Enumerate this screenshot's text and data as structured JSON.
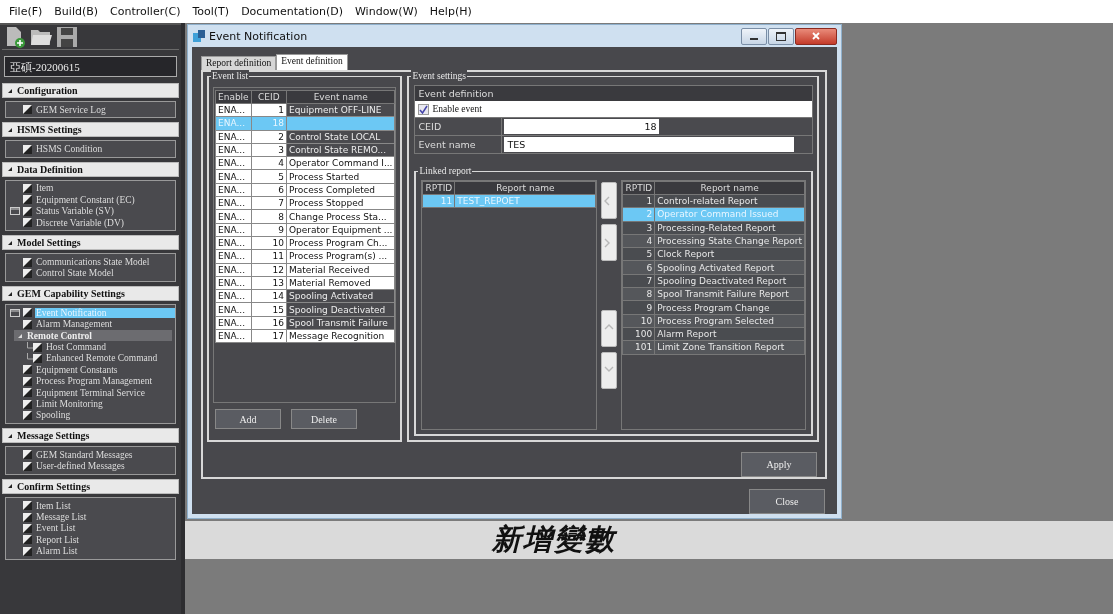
{
  "menu": [
    "File(F)",
    "Build(B)",
    "Controller(C)",
    "Tool(T)",
    "Documentation(D)",
    "Window(W)",
    "Help(H)"
  ],
  "project_name": "亞碩-20200615",
  "sidebar": [
    {
      "title": "Configuration",
      "items": [
        {
          "label": "GEM Service Log",
          "marked": false,
          "selected": false
        }
      ]
    },
    {
      "title": "HSMS Settings",
      "items": [
        {
          "label": "HSMS Condition",
          "marked": false,
          "selected": false
        }
      ]
    },
    {
      "title": "Data Definition",
      "items": [
        {
          "label": "Item",
          "marked": false,
          "selected": false
        },
        {
          "label": "Equipment Constant (EC)",
          "marked": false,
          "selected": false
        },
        {
          "label": "Status Variable (SV)",
          "marked": true,
          "selected": false
        },
        {
          "label": "Discrete Variable (DV)",
          "marked": false,
          "selected": false
        }
      ]
    },
    {
      "title": "Model Settings",
      "items": [
        {
          "label": "Communications State Model",
          "marked": false,
          "selected": false
        },
        {
          "label": "Control State Model",
          "marked": false,
          "selected": false
        }
      ]
    },
    {
      "title": "GEM Capability Settings",
      "items": [
        {
          "label": "Event Notification",
          "marked": true,
          "selected": true
        },
        {
          "label": "Alarm Management",
          "marked": false,
          "selected": false
        },
        {
          "label": "Remote Control",
          "kind": "group",
          "expanded": true,
          "children": [
            {
              "label": "Host Command",
              "marked": false,
              "selected": false
            },
            {
              "label": "Enhanced Remote Command",
              "marked": false,
              "selected": false
            }
          ]
        },
        {
          "label": "Equipment Constants",
          "marked": false,
          "selected": false
        },
        {
          "label": "Process Program Management",
          "marked": false,
          "selected": false
        },
        {
          "label": "Equipment Terminal Service",
          "marked": false,
          "selected": false
        },
        {
          "label": "Limit Monitoring",
          "marked": false,
          "selected": false
        },
        {
          "label": "Spooling",
          "marked": false,
          "selected": false
        }
      ]
    },
    {
      "title": "Message Settings",
      "items": [
        {
          "label": "GEM Standard Messages",
          "marked": false,
          "selected": false
        },
        {
          "label": "User-defined Messages",
          "marked": false,
          "selected": false
        }
      ]
    },
    {
      "title": "Confirm Settings",
      "items": [
        {
          "label": "Item List",
          "marked": false,
          "selected": false
        },
        {
          "label": "Message List",
          "marked": false,
          "selected": false
        },
        {
          "label": "Event List",
          "marked": false,
          "selected": false
        },
        {
          "label": "Report List",
          "marked": false,
          "selected": false
        },
        {
          "label": "Alarm List",
          "marked": false,
          "selected": false
        }
      ]
    }
  ],
  "dialog": {
    "title": "Event Notification",
    "tabs": [
      {
        "label": "Report definition",
        "selected": false
      },
      {
        "label": "Event definition",
        "selected": true
      }
    ],
    "event_list": {
      "title": "Event list",
      "columns": [
        "Enable",
        "CEID",
        "Event name"
      ],
      "rows": [
        {
          "enable": "ENA...",
          "ceid": "1",
          "name": "Equipment OFF-LINE",
          "shaded": true,
          "selected": false
        },
        {
          "enable": "ENA...",
          "ceid": "18",
          "shaded": false,
          "selected": true
        },
        {
          "enable": "ENA...",
          "ceid": "2",
          "name": "Control State LOCAL",
          "shaded": true,
          "selected": false
        },
        {
          "enable": "ENA...",
          "ceid": "3",
          "name": "Control State REMO...",
          "shaded": true,
          "selected": false
        },
        {
          "enable": "ENA...",
          "ceid": "4",
          "name": "Operator Command I...",
          "shaded": false,
          "selected": false
        },
        {
          "enable": "ENA...",
          "ceid": "5",
          "name": "Process Started",
          "shaded": false,
          "selected": false
        },
        {
          "enable": "ENA...",
          "ceid": "6",
          "name": "Process Completed",
          "shaded": false,
          "selected": false
        },
        {
          "enable": "ENA...",
          "ceid": "7",
          "name": "Process Stopped",
          "shaded": false,
          "selected": false
        },
        {
          "enable": "ENA...",
          "ceid": "8",
          "name": "Change Process Sta...",
          "shaded": false,
          "selected": false
        },
        {
          "enable": "ENA...",
          "ceid": "9",
          "name": "Operator Equipment ...",
          "shaded": false,
          "selected": false
        },
        {
          "enable": "ENA...",
          "ceid": "10",
          "name": "Process Program Ch...",
          "shaded": false,
          "selected": false
        },
        {
          "enable": "ENA...",
          "ceid": "11",
          "name": "Process Program(s) ...",
          "shaded": false,
          "selected": false
        },
        {
          "enable": "ENA...",
          "ceid": "12",
          "name": "Material Received",
          "shaded": false,
          "selected": false
        },
        {
          "enable": "ENA...",
          "ceid": "13",
          "name": "Material Removed",
          "shaded": false,
          "selected": false
        },
        {
          "enable": "ENA...",
          "ceid": "14",
          "name": "Spooling Activated",
          "shaded": true,
          "selected": false
        },
        {
          "enable": "ENA...",
          "ceid": "15",
          "name": "Spooling Deactivated",
          "shaded": true,
          "selected": false
        },
        {
          "enable": "ENA...",
          "ceid": "16",
          "name": "Spool Transmit Failure",
          "shaded": true,
          "selected": false
        },
        {
          "enable": "ENA...",
          "ceid": "17",
          "name": "Message Recognition",
          "shaded": false,
          "selected": false
        }
      ],
      "buttons": [
        "Add",
        "Delete"
      ]
    },
    "event_settings": {
      "title": "Event settings",
      "header": "Event definition",
      "enable_label": "Enable event",
      "enable_checked": true,
      "ceid_label": "CEID",
      "ceid_value": "18",
      "name_label": "Event name",
      "name_value": "TES"
    },
    "linked_report": {
      "title": "Linked report",
      "columns": [
        "RPTID",
        "Report name"
      ],
      "rows": [
        {
          "rptid": "11",
          "name": "TEST_REPOET",
          "selected": true
        }
      ]
    },
    "report_list": {
      "columns": [
        "RPTID",
        "Report name"
      ],
      "rows": [
        {
          "rptid": "1",
          "name": "Control-related Report",
          "selected": false
        },
        {
          "rptid": "2",
          "name": "Operator Command Issued",
          "selected": true
        },
        {
          "rptid": "3",
          "name": "Processing-Related Report",
          "selected": false
        },
        {
          "rptid": "4",
          "name": "Processing State Change Report",
          "selected": false
        },
        {
          "rptid": "5",
          "name": "Clock Report",
          "selected": false
        },
        {
          "rptid": "6",
          "name": "Spooling Activated Report",
          "selected": false
        },
        {
          "rptid": "7",
          "name": "Spooling Deactivated Report",
          "selected": false
        },
        {
          "rptid": "8",
          "name": "Spool Transmit Failure Report",
          "selected": false
        },
        {
          "rptid": "9",
          "name": "Process Program Change",
          "selected": false
        },
        {
          "rptid": "10",
          "name": "Process Program Selected",
          "selected": false
        },
        {
          "rptid": "100",
          "name": "Alarm Report",
          "selected": false
        },
        {
          "rptid": "101",
          "name": "Limit Zone Transition Report",
          "selected": false
        }
      ]
    },
    "apply": "Apply",
    "close": "Close"
  },
  "subtitle": "新增變數"
}
